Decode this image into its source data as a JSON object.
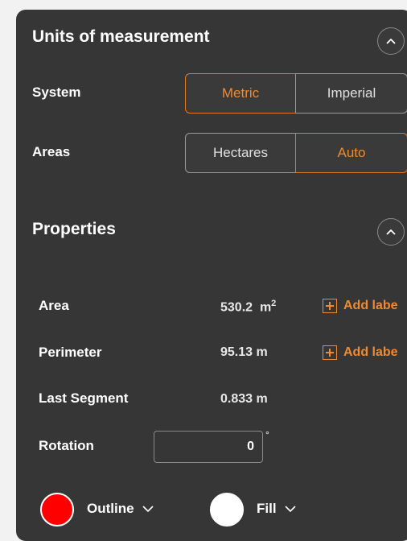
{
  "units": {
    "title": "Units of measurement",
    "system_label": "System",
    "system_options": [
      "Metric",
      "Imperial"
    ],
    "system_selected": "Metric",
    "areas_label": "Areas",
    "areas_options": [
      "Hectares",
      "Auto"
    ],
    "areas_selected": "Auto"
  },
  "properties": {
    "title": "Properties",
    "area_label": "Area",
    "area_value": "530.2",
    "area_unit": "m",
    "area_unit_exp": "2",
    "perimeter_label": "Perimeter",
    "perimeter_value": "95.13 m",
    "last_segment_label": "Last Segment",
    "last_segment_value": "0.833 m",
    "rotation_label": "Rotation",
    "rotation_value": "0",
    "rotation_unit": "°",
    "add_label": "Add labe"
  },
  "style": {
    "outline_label": "Outline",
    "outline_color": "#ff0000",
    "fill_label": "Fill",
    "fill_color": "#ffffff"
  },
  "colors": {
    "accent": "#f08a30",
    "panel_bg": "#363636"
  }
}
